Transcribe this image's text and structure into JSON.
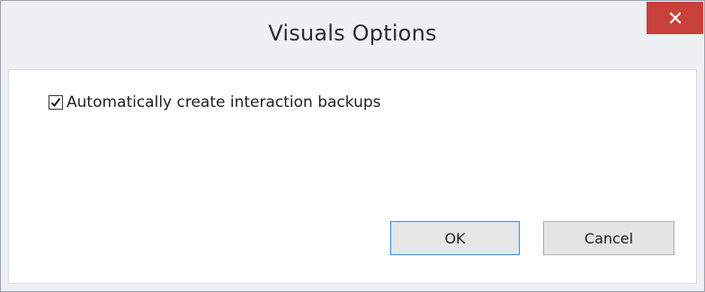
{
  "window": {
    "title": "Visuals Options"
  },
  "options": {
    "auto_backup": {
      "label": "Automatically create interaction backups",
      "checked": true
    }
  },
  "buttons": {
    "ok_label": "OK",
    "cancel_label": "Cancel"
  },
  "icons": {
    "close": "close-icon",
    "check": "checkmark-icon"
  },
  "colors": {
    "close_button": "#c8403a",
    "ok_focus_border": "#3c8fdb"
  }
}
